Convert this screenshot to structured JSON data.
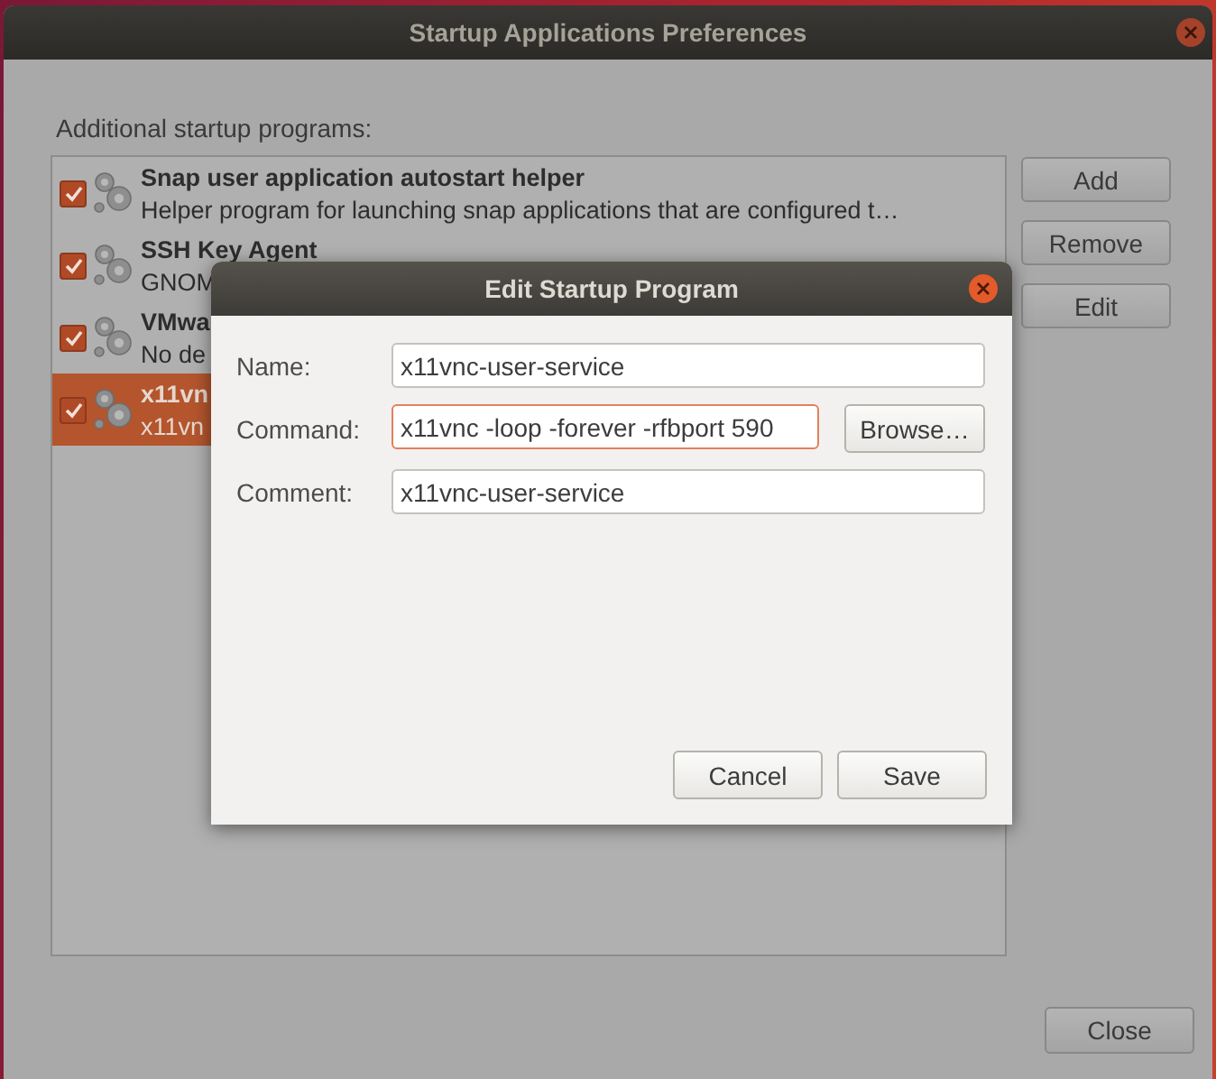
{
  "window": {
    "title": "Startup Applications Preferences",
    "heading": "Additional startup programs:",
    "programs": [
      {
        "name": "Snap user application autostart helper",
        "description": "Helper program for launching snap applications that are configured t…",
        "checked": true,
        "selected": false
      },
      {
        "name": "SSH Key Agent",
        "description": "GNOM",
        "checked": true,
        "selected": false
      },
      {
        "name": "VMwa",
        "description": "No de",
        "checked": true,
        "selected": false
      },
      {
        "name": "x11vn",
        "description": "x11vn",
        "checked": true,
        "selected": true
      }
    ],
    "buttons": [
      "Add",
      "Remove",
      "Edit"
    ],
    "close_button": "Close"
  },
  "dialog": {
    "title": "Edit Startup Program",
    "fields": [
      {
        "label": "Name:",
        "value": "x11vnc-user-service",
        "focused": false
      },
      {
        "label": "Command:",
        "value": "x11vnc -loop -forever -rfbport 590",
        "focused": true,
        "button": "Browse…"
      },
      {
        "label": "Comment:",
        "value": "x11vnc-user-service",
        "focused": false
      }
    ],
    "buttons": [
      "Cancel",
      "Save"
    ]
  }
}
